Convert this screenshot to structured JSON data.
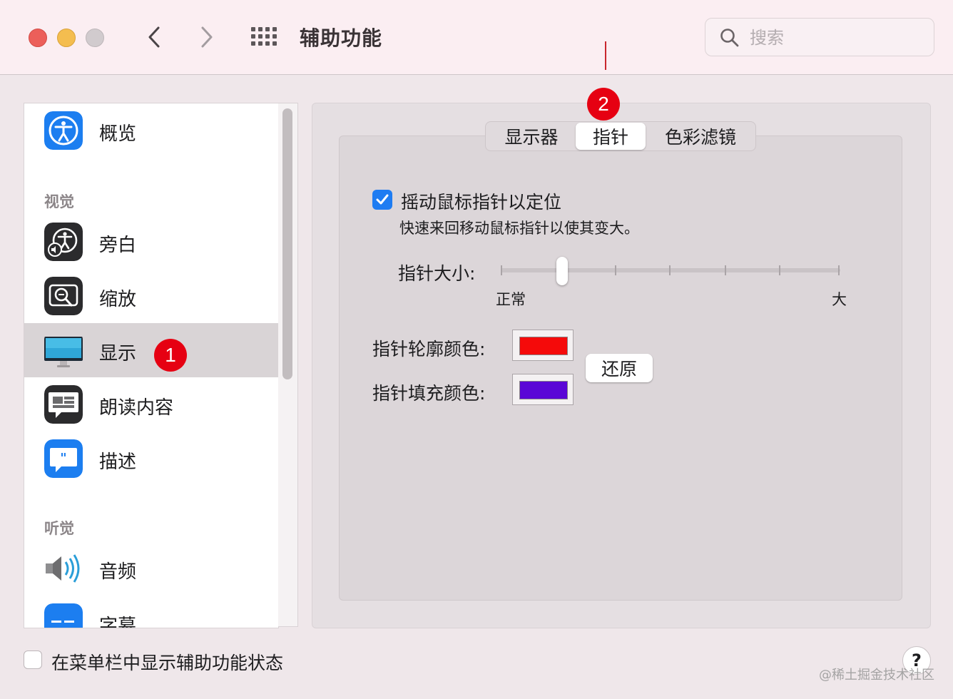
{
  "window": {
    "title": "辅助功能",
    "search_placeholder": "搜索"
  },
  "colors": {
    "accent": "#1e7cf2",
    "badge": "#e60012",
    "outline_color": "#f50a0a",
    "fill_color": "#5a06d6"
  },
  "sidebar": {
    "items": [
      {
        "label": "概览",
        "icon": "accessibility-icon"
      },
      {
        "label": "旁白",
        "icon": "voiceover-icon"
      },
      {
        "label": "缩放",
        "icon": "zoom-icon"
      },
      {
        "label": "显示",
        "icon": "display-icon",
        "selected": true
      },
      {
        "label": "朗读内容",
        "icon": "spoken-content-icon"
      },
      {
        "label": "描述",
        "icon": "descriptions-icon"
      },
      {
        "label": "音频",
        "icon": "audio-icon"
      },
      {
        "label": "字幕",
        "icon": "captions-icon"
      }
    ],
    "sections": {
      "vision": "视觉",
      "hearing": "听觉"
    }
  },
  "badges": {
    "one": "1",
    "two": "2"
  },
  "tabs": {
    "display": "显示器",
    "pointer": "指针",
    "color_filters": "色彩滤镜",
    "active": "pointer"
  },
  "pointer": {
    "shake_label": "摇动鼠标指针以定位",
    "shake_checked": true,
    "shake_desc": "快速来回移动鼠标指针以使其变大。",
    "size_label": "指针大小:",
    "size_min": "正常",
    "size_max": "大",
    "size_value": 0.18,
    "outline_label": "指针轮廓颜色:",
    "fill_label": "指针填充颜色:",
    "restore_label": "还原"
  },
  "footer": {
    "menubar_label": "在菜单栏中显示辅助功能状态",
    "menubar_checked": false,
    "help": "?",
    "watermark": "@稀土掘金技术社区"
  }
}
